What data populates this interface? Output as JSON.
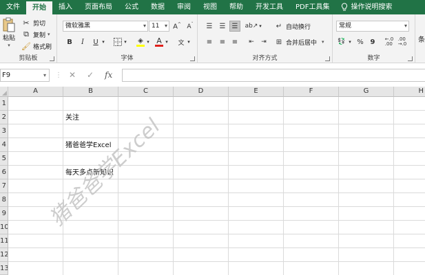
{
  "ribbon_tabs": [
    "文件",
    "开始",
    "插入",
    "页面布局",
    "公式",
    "数据",
    "审阅",
    "视图",
    "帮助",
    "开发工具",
    "PDF工具集"
  ],
  "active_tab": "开始",
  "tell_me": "操作说明搜索",
  "clipboard": {
    "paste": "粘贴",
    "cut": "剪切",
    "copy": "复制",
    "format_painter": "格式刷",
    "label": "剪贴板"
  },
  "font": {
    "name": "微软雅黑",
    "size": "11",
    "bold": "B",
    "italic": "I",
    "underline": "U",
    "label": "字体"
  },
  "alignment": {
    "wrap": "自动换行",
    "merge": "合并后居中",
    "label": "对齐方式"
  },
  "number": {
    "format": "常规",
    "percent": "%",
    "comma": "9",
    "label": "数字"
  },
  "next_group_clip": "条",
  "name_box": "F9",
  "formula": "",
  "columns": [
    "A",
    "B",
    "C",
    "D",
    "E",
    "F",
    "G",
    "H"
  ],
  "rows": [
    "1",
    "2",
    "3",
    "4",
    "5",
    "6",
    "7",
    "8",
    "9",
    "10",
    "11",
    "12",
    "13"
  ],
  "cells": {
    "B2": "关注",
    "B4": "猪爸爸学Excel",
    "B6": "每天多点新知识"
  },
  "watermark": "猪爸爸学Excel",
  "colors": {
    "ribbon": "#217346",
    "font_color_bar": "#e0201b"
  }
}
